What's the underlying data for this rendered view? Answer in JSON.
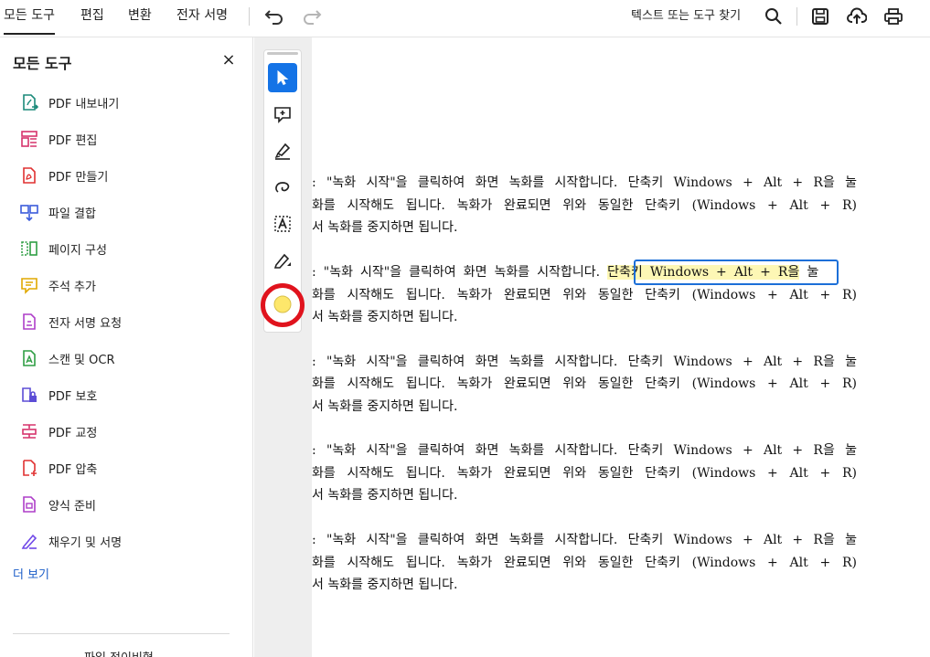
{
  "topbar": {
    "menus": [
      "모든 도구",
      "편집",
      "변환",
      "전자 서명"
    ],
    "search_label": "텍스트 또는 도구 찾기"
  },
  "sidebar": {
    "title": "모든 도구",
    "close": "×",
    "items": [
      {
        "label": "PDF 내보내기",
        "icon": "pdf-export-icon",
        "color": "#1b8a7a"
      },
      {
        "label": "PDF 편집",
        "icon": "pdf-edit-icon",
        "color": "#d6336c"
      },
      {
        "label": "PDF 만들기",
        "icon": "pdf-create-icon",
        "color": "#e03131"
      },
      {
        "label": "파일 결합",
        "icon": "combine-files-icon",
        "color": "#3b5bdb"
      },
      {
        "label": "페이지 구성",
        "icon": "organize-pages-icon",
        "color": "#2f9e44"
      },
      {
        "label": "주석 추가",
        "icon": "comment-icon",
        "color": "#e0a800"
      },
      {
        "label": "전자 서명 요청",
        "icon": "request-esign-icon",
        "color": "#ae3ec9"
      },
      {
        "label": "스캔 및 OCR",
        "icon": "scan-ocr-icon",
        "color": "#2f9e44"
      },
      {
        "label": "PDF 보호",
        "icon": "protect-pdf-icon",
        "color": "#5c4dd6"
      },
      {
        "label": "PDF 교정",
        "icon": "redact-pdf-icon",
        "color": "#d6336c"
      },
      {
        "label": "PDF 압축",
        "icon": "compress-pdf-icon",
        "color": "#e03131"
      },
      {
        "label": "양식 준비",
        "icon": "prepare-form-icon",
        "color": "#ae3ec9"
      },
      {
        "label": "채우기 및 서명",
        "icon": "fill-sign-icon",
        "color": "#7048e8"
      }
    ],
    "more": "더 보기",
    "bottom_text": "파일 정이비협"
  },
  "document": {
    "line1": ": \"녹화 시작\"을 클릭하여 화면 녹화를 시작합니다. 단축키 Windows + Alt + R을 눌",
    "line1_pre": ": \"녹화 시작\"을 클릭하여 화면 녹화를 시작합니다. ",
    "line1_highlight": "단축키 Windows + Alt + R을",
    "line1_post": " 눌",
    "line2": "화를 시작해도 됩니다. 녹화가 완료되면 위와 동일한 단축키 (Windows + Alt + R)",
    "line3": "서 녹화를 중지하면 됩니다."
  },
  "colors": {
    "accent": "#1473e6",
    "highlight_fill": "#fdf7b5",
    "annotation_ring": "#e0131d"
  }
}
